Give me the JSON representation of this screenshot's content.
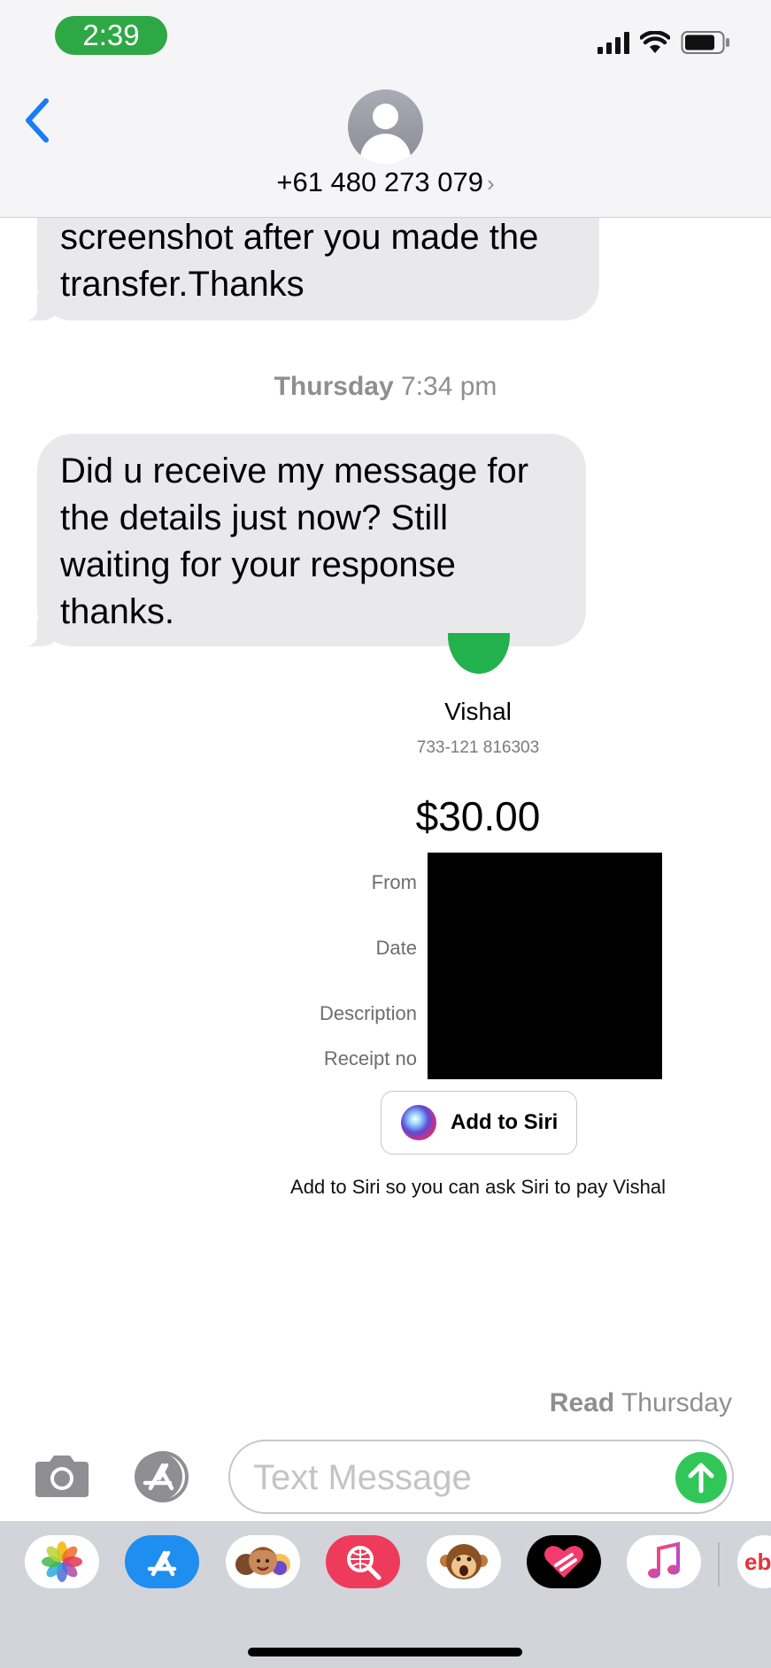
{
  "status_bar": {
    "time": "2:39"
  },
  "header": {
    "contact": "+61 480 273 079",
    "chevron": "›"
  },
  "messages": [
    {
      "lines": [
        "screenshot after you made the",
        "transfer.Thanks"
      ]
    },
    {
      "lines": [
        "Did u receive my message for",
        "the details just now? Still",
        "waiting for your response",
        "thanks."
      ]
    }
  ],
  "timestamp": {
    "day": "Thursday",
    "time": "7:34 pm"
  },
  "payment": {
    "payee": "Vishal",
    "account": "733-121 816303",
    "amount": "$30.00",
    "labels": {
      "from": "From",
      "date": "Date",
      "description": "Description",
      "receipt": "Receipt no"
    },
    "siri_button": "Add to Siri",
    "siri_caption": "Add to Siri so you can ask Siri to pay Vishal"
  },
  "read_receipt": {
    "status": "Read",
    "day": "Thursday"
  },
  "composer": {
    "placeholder": "Text Message"
  },
  "app_drawer": {
    "apps": [
      "photos-icon",
      "app-store-icon",
      "memoji-icon",
      "web-search-icon",
      "animoji-icon",
      "digital-touch-icon",
      "music-icon",
      "ebay-icon"
    ],
    "ebay_label": "eb"
  },
  "colors": {
    "accent_blue": "#1a7cf5",
    "send_green": "#30c758",
    "time_pill": "#2ea845",
    "bubble": "#e9e9eb"
  }
}
